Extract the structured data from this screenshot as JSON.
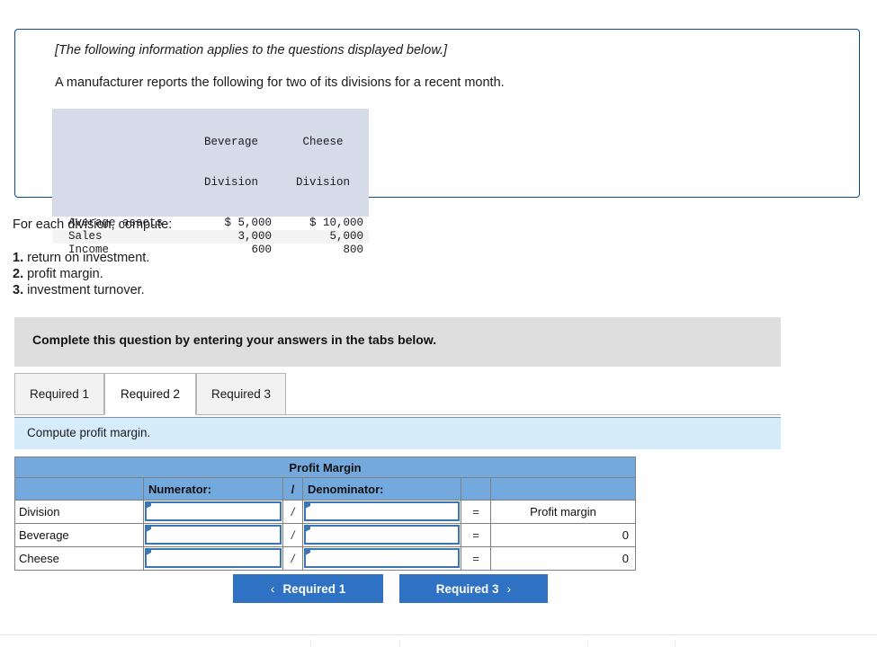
{
  "info_box": {
    "intro": "[The following information applies to the questions displayed below.]",
    "description": "A manufacturer reports the following for two of its divisions for a recent month.",
    "scenario_table": {
      "headers": [
        {
          "line1": "",
          "line2": ""
        },
        {
          "line1": "Beverage",
          "line2": "Division"
        },
        {
          "line1": "Cheese",
          "line2": "Division"
        }
      ],
      "rows": [
        {
          "label": "Average assets",
          "beverage": "$ 5,000",
          "cheese": "$ 10,000"
        },
        {
          "label": "Sales",
          "beverage": "3,000",
          "cheese": "5,000"
        },
        {
          "label": "Income",
          "beverage": "600",
          "cheese": "800"
        }
      ]
    }
  },
  "prompt": {
    "lead": "For each division, compute:",
    "requirements": [
      {
        "num": "1.",
        "text": " return on investment."
      },
      {
        "num": "2.",
        "text": " profit margin."
      },
      {
        "num": "3.",
        "text": " investment turnover."
      }
    ]
  },
  "instruction_banner": {
    "text": "Complete this question by entering your answers in the tabs below."
  },
  "tabs": [
    {
      "label": "Required 1",
      "active": false
    },
    {
      "label": "Required 2",
      "active": true
    },
    {
      "label": "Required 3",
      "active": false
    }
  ],
  "subinstruction": {
    "text": "Compute profit margin."
  },
  "worksheet": {
    "title": "Profit Margin",
    "column_headers": {
      "label": "",
      "numerator": "Numerator:",
      "slash": "/",
      "denominator": "Denominator:",
      "equals": "",
      "result": ""
    },
    "rows": [
      {
        "label": "Division",
        "numerator_value": "",
        "slash": "/",
        "denominator_value": "",
        "equals": "=",
        "result": "Profit margin",
        "result_align": "center"
      },
      {
        "label": "Beverage",
        "numerator_value": "",
        "slash": "/",
        "denominator_value": "",
        "equals": "=",
        "result": "0",
        "result_align": "right"
      },
      {
        "label": "Cheese",
        "numerator_value": "",
        "slash": "/",
        "denominator_value": "",
        "equals": "=",
        "result": "0",
        "result_align": "right"
      }
    ]
  },
  "nav": {
    "prev_label": "Required 1",
    "prev_chevron": "‹",
    "next_label": "Required 3",
    "next_chevron": "›"
  },
  "colors": {
    "info_border": "#0b4a87",
    "banner_gray": "#dedede",
    "subinstruction_blue": "#d7ecfa",
    "table_header_blue": "#74a9dd",
    "entry_border": "#3a75b5",
    "button_blue": "#2f72c4",
    "scenario_header_bg": "#d6dbe9",
    "scenario_alt_row": "#f4f4f4"
  }
}
